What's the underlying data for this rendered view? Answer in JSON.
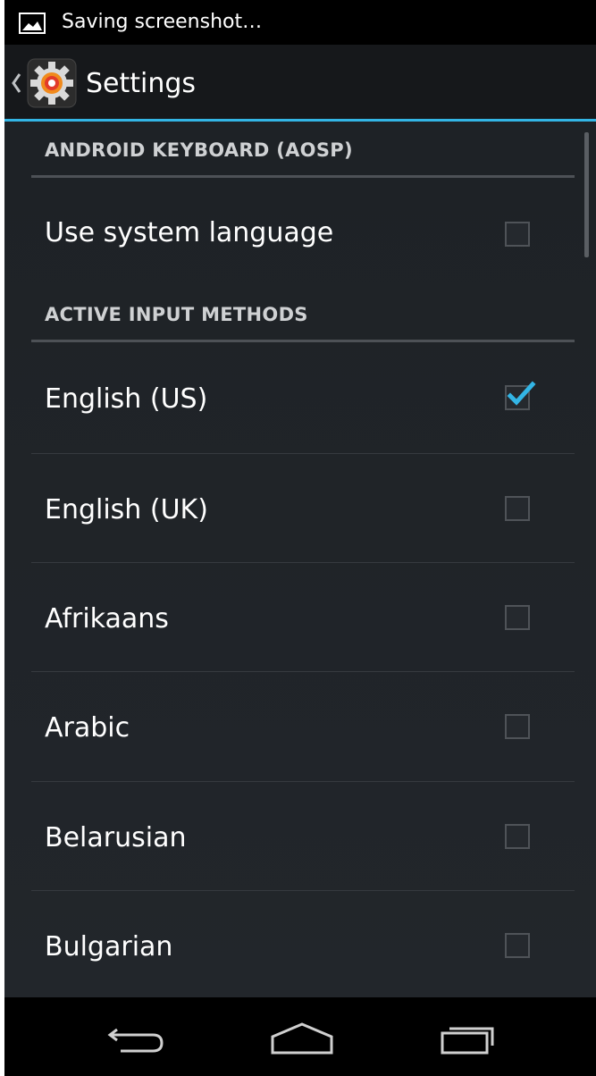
{
  "status_bar": {
    "text": "Saving screenshot…",
    "icon": "image-icon"
  },
  "action_bar": {
    "title": "Settings",
    "icon": "settings-gear-icon"
  },
  "sections": [
    {
      "header": "ANDROID KEYBOARD (AOSP)",
      "items": [
        {
          "label": "Use system language",
          "checked": false
        }
      ]
    },
    {
      "header": "ACTIVE INPUT METHODS",
      "items": [
        {
          "label": "English (US)",
          "checked": true
        },
        {
          "label": "English (UK)",
          "checked": false
        },
        {
          "label": "Afrikaans",
          "checked": false
        },
        {
          "label": "Arabic",
          "checked": false
        },
        {
          "label": "Belarusian",
          "checked": false
        },
        {
          "label": "Bulgarian",
          "checked": false
        }
      ]
    }
  ],
  "nav_bar": {
    "back": "back-icon",
    "home": "home-icon",
    "recents": "recents-icon"
  },
  "colors": {
    "accent": "#33b5e5",
    "background": "#1b1e22"
  }
}
